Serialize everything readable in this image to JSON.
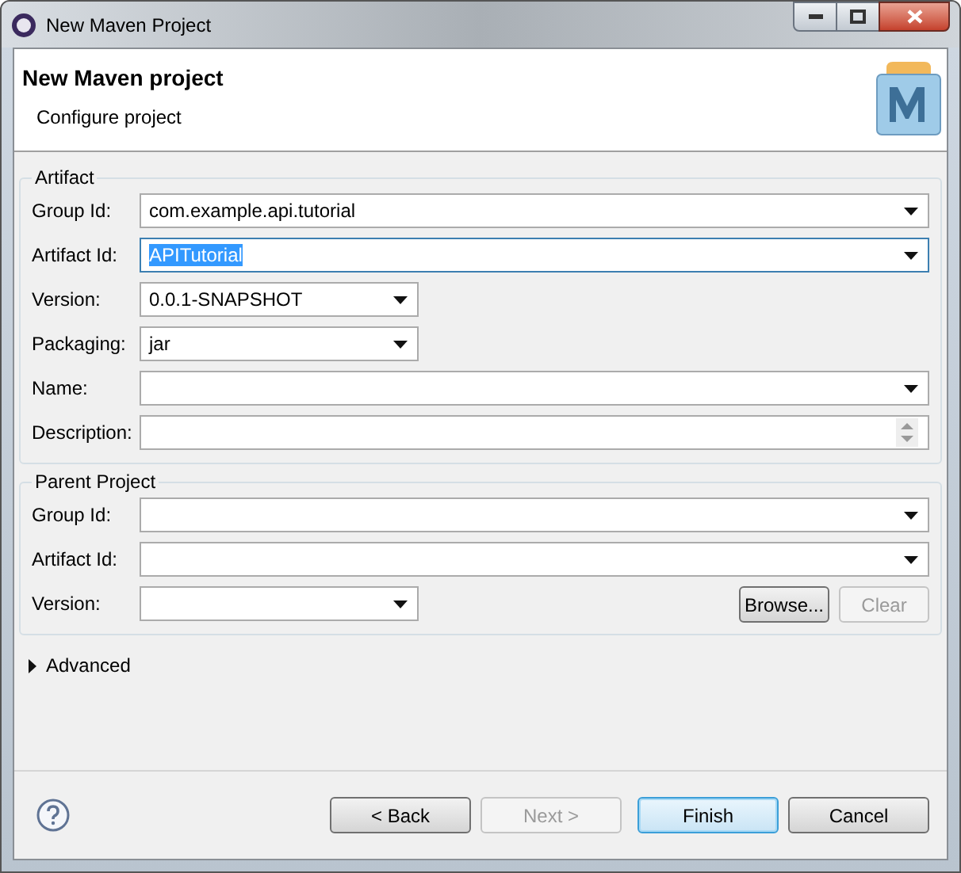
{
  "window": {
    "title": "New Maven Project"
  },
  "header": {
    "title": "New Maven project",
    "subtitle": "Configure project"
  },
  "artifact": {
    "legend": "Artifact",
    "fields": [
      {
        "label": "Group Id:",
        "value": "com.example.api.tutorial",
        "kind": "combo",
        "focused": false
      },
      {
        "label": "Artifact Id:",
        "value": "APITutorial",
        "kind": "combo",
        "focused": true
      },
      {
        "label": "Version:",
        "value": "0.0.1-SNAPSHOT",
        "kind": "narrow",
        "focused": false
      },
      {
        "label": "Packaging:",
        "value": "jar",
        "kind": "narrow",
        "focused": false
      },
      {
        "label": "Name:",
        "kind": "combo",
        "focused": false
      },
      {
        "label": "Description:",
        "kind": "memo",
        "focused": false
      }
    ]
  },
  "parent": {
    "legend": "Parent Project",
    "fields": [
      {
        "label": "Group Id:",
        "kind": "combo",
        "focused": false
      },
      {
        "label": "Artifact Id:",
        "kind": "combo",
        "focused": false
      },
      {
        "label": "Version:",
        "kind": "narrow",
        "focused": false
      }
    ],
    "buttons": [
      {
        "label": "Browse...",
        "disabled": false
      },
      {
        "label": "Clear",
        "disabled": true
      }
    ]
  },
  "advanced": {
    "label": "Advanced",
    "expanded": false
  },
  "buttons": [
    {
      "label": "< Back",
      "disabled": false,
      "default": false
    },
    {
      "label": "Next >",
      "disabled": true,
      "default": false
    },
    {
      "label": "Finish",
      "disabled": false,
      "default": true
    },
    {
      "label": "Cancel",
      "disabled": false,
      "default": false
    }
  ]
}
